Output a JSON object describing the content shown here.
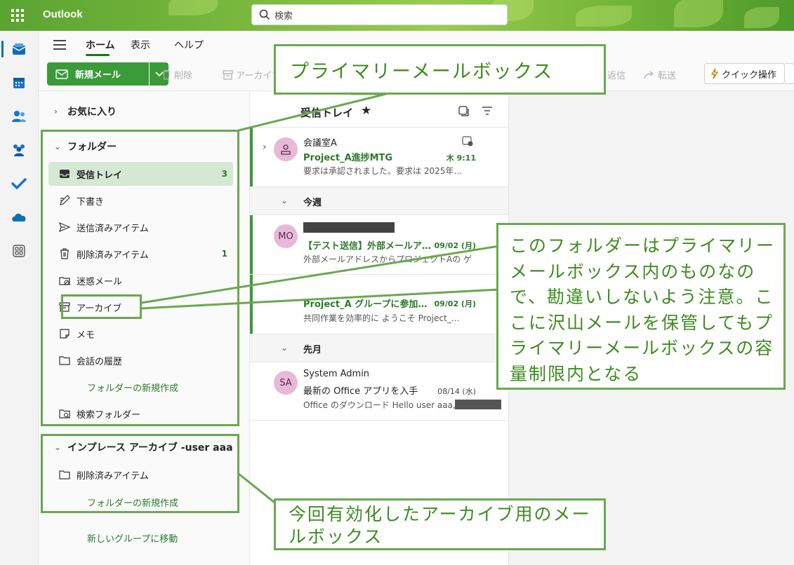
{
  "app": {
    "title": "Outlook"
  },
  "search": {
    "placeholder": "検索"
  },
  "ribbon": {
    "tabs": [
      "ホーム",
      "表示",
      "ヘルプ"
    ],
    "new_mail": "新規メール",
    "delete": "削除",
    "archive": "アーカイブ",
    "reply": "返信",
    "forward": "転送",
    "quick_action": "クイック操作"
  },
  "folder_pane": {
    "favorites": "お気に入り",
    "folders_header": "フォルダー",
    "folders": [
      {
        "label": "受信トレイ",
        "icon": "inbox-icon",
        "count": "3",
        "selected": true
      },
      {
        "label": "下書き",
        "icon": "draft-pencil-icon",
        "count": ""
      },
      {
        "label": "送信済みアイテム",
        "icon": "send-icon",
        "count": ""
      },
      {
        "label": "削除済みアイテム",
        "icon": "trash-icon",
        "count": "1"
      },
      {
        "label": "迷惑メール",
        "icon": "junk-folder-icon",
        "count": ""
      },
      {
        "label": "アーカイブ",
        "icon": "archive-icon",
        "count": ""
      },
      {
        "label": "メモ",
        "icon": "note-icon",
        "count": ""
      },
      {
        "label": "会話の履歴",
        "icon": "folder-icon",
        "count": ""
      }
    ],
    "new_folder": "フォルダーの新規作成",
    "search_folder": "検索フォルダー",
    "archive_header": "インプレース アーカイブ -user aaa",
    "archive_deleted": "削除済みアイテム",
    "archive_new_folder": "フォルダーの新規作成",
    "move_to_group": "新しいグループに移動"
  },
  "message_list": {
    "title": "受信トレイ",
    "messages": [
      {
        "sender": "会議室A",
        "subject": "Project_A進捗MTG",
        "time": "木 9:11",
        "preview": "要求は承認されました。要求は 2025年…",
        "avatar": ""
      },
      {
        "sender": "",
        "subject": "【テスト送信】外部メールア…",
        "time": "09/02 (月)",
        "preview": "外部メールアドレスからプロジェクトAの ゲ",
        "avatar": "MO"
      },
      {
        "sender": "",
        "subject": "Project_A グループに参加…",
        "time": "09/02 (月)",
        "preview": "共同作業を効率的に ようこそ Project_…",
        "avatar": ""
      },
      {
        "sender": "System Admin",
        "subject": "最新の Office アプリを入手",
        "time": "08/14 (水)",
        "preview": "Office のダウンロード Hello user aaa,",
        "avatar": "SA"
      }
    ],
    "groups": [
      "今週",
      "先月"
    ]
  },
  "callouts": {
    "primary": "プライマリーメールボックス",
    "note": "このフォルダーはプライマリーメールボックス内のものなので、勘違いしないよう注意。ここに沢山メールを保管してもプライマリーメールボックスの容量制限内となる",
    "archive": "今回有効化したアーカイブ用のメールボックス"
  }
}
